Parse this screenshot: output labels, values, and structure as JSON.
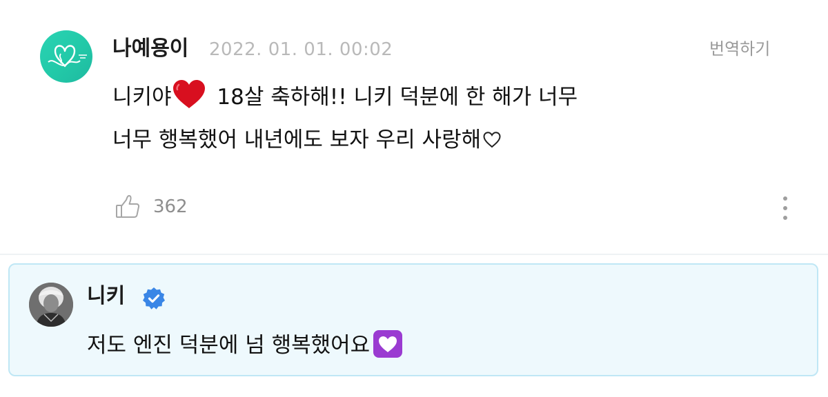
{
  "comment": {
    "author": "나예용이",
    "timestamp": "2022. 01. 01. 00:02",
    "translate_label": "번역하기",
    "text_line1": "니키야",
    "text_line1_rest": " 18살 축하해!! 니키 덕분에 한 해가 너무",
    "text_line2": "너무 행복했어 내년에도 보자 우리 사랑해",
    "like_count": "362",
    "icons": {
      "avatar": "fan-avatar",
      "heart": "red-heart-emoji",
      "heart_outline": "white-heart-symbol",
      "like": "thumbs-up-icon",
      "more": "more-vertical-icon"
    }
  },
  "reply": {
    "author": "니키",
    "text": "저도 엔진 덕분에 넘 행복했어요",
    "icons": {
      "avatar": "artist-avatar",
      "badge": "verified-badge-icon",
      "heart": "purple-heart-emoji"
    },
    "colors": {
      "background": "#eef9fd",
      "border": "#bfe7f5",
      "badge": "#3a86e6"
    }
  }
}
